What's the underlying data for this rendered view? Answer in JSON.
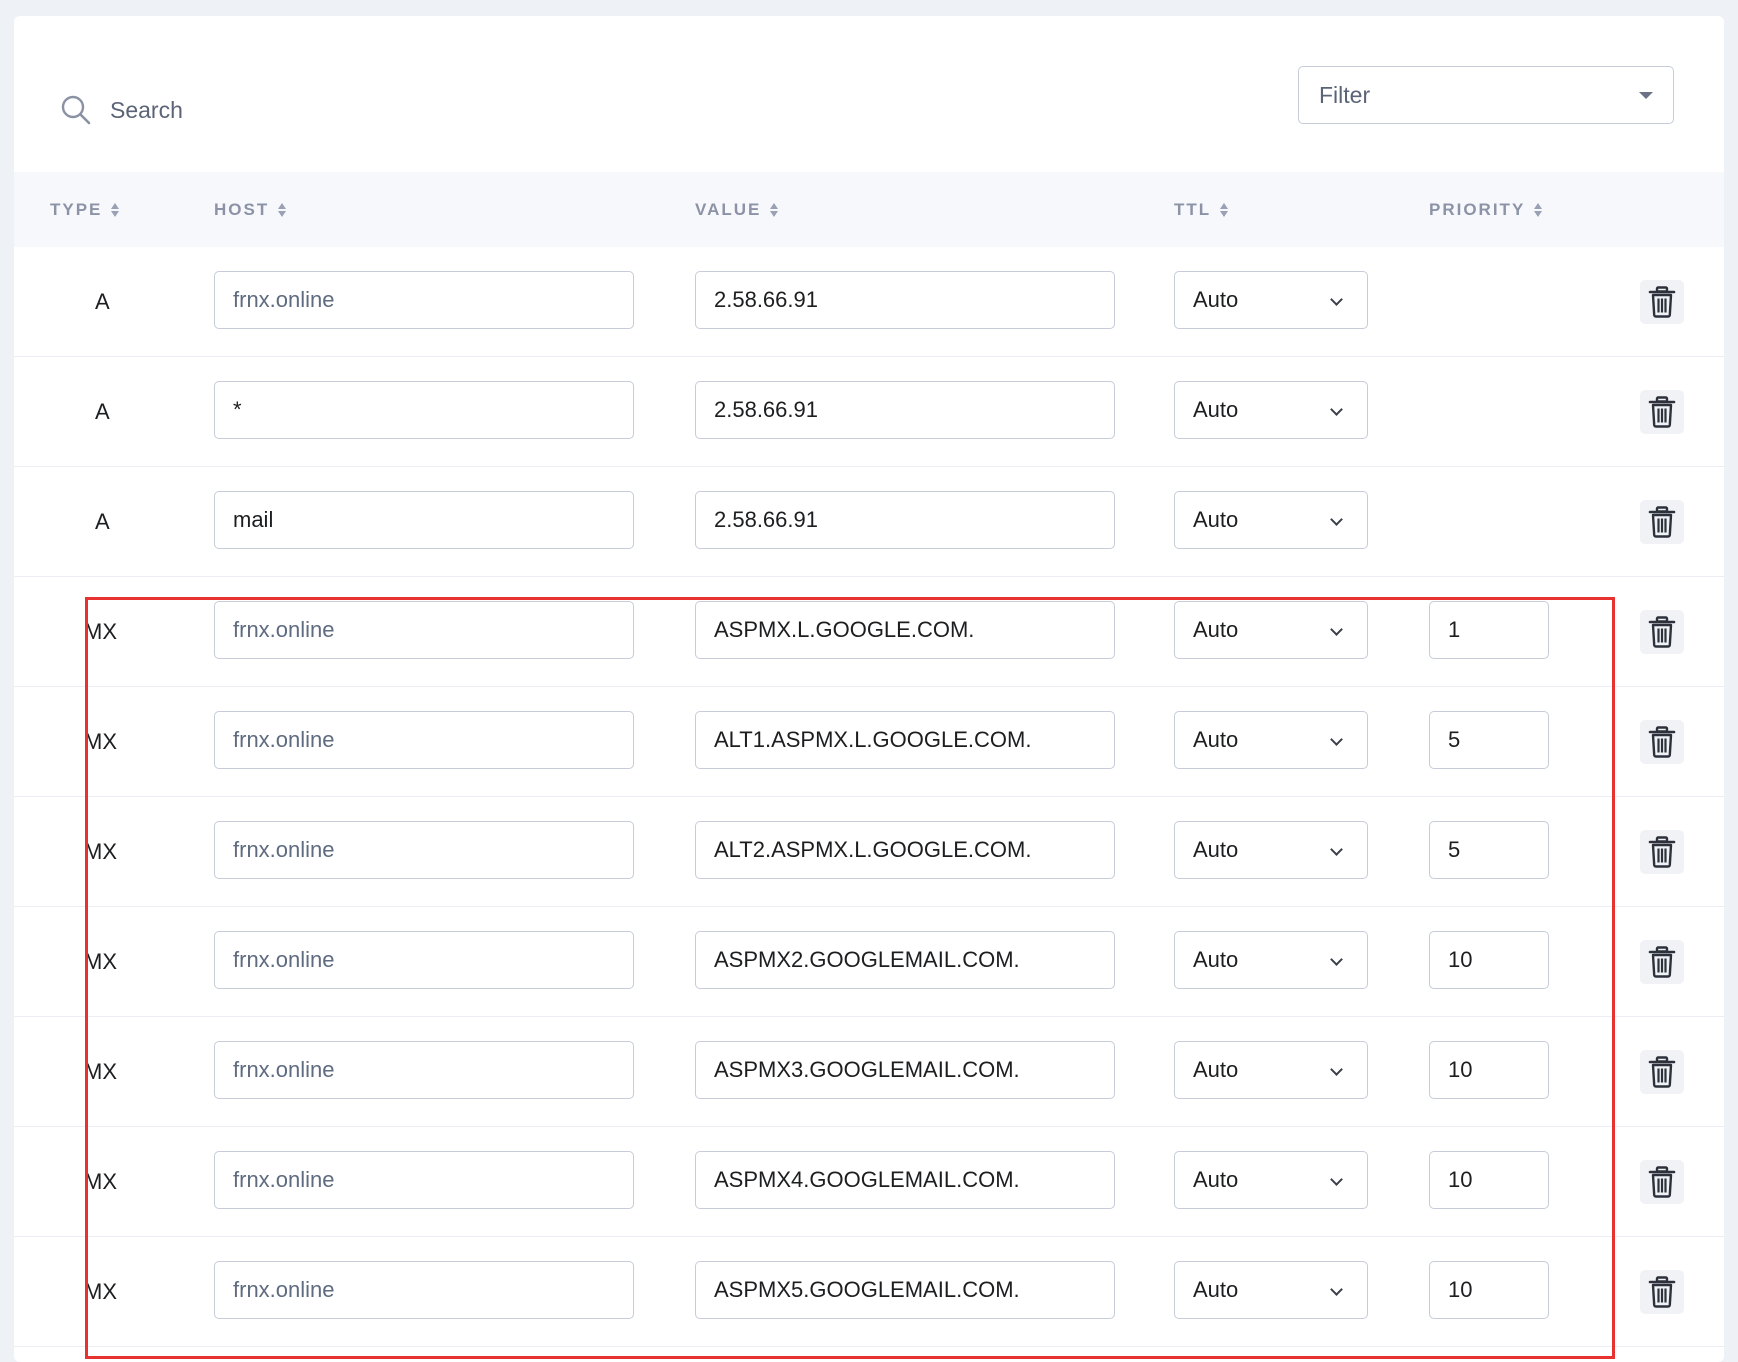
{
  "toolbar": {
    "search_label": "Search",
    "filter_label": "Filter"
  },
  "columns": [
    "TYPE",
    "HOST",
    "VALUE",
    "TTL",
    "PRIORITY"
  ],
  "records": [
    {
      "type": "A",
      "host": "frnx.online",
      "host_is_placeholder": true,
      "value": "2.58.66.91",
      "ttl": "Auto",
      "priority": ""
    },
    {
      "type": "A",
      "host": "*",
      "host_is_placeholder": false,
      "value": "2.58.66.91",
      "ttl": "Auto",
      "priority": ""
    },
    {
      "type": "A",
      "host": "mail",
      "host_is_placeholder": false,
      "value": "2.58.66.91",
      "ttl": "Auto",
      "priority": ""
    },
    {
      "type": "MX",
      "host": "frnx.online",
      "host_is_placeholder": true,
      "value": "ASPMX.L.GOOGLE.COM.",
      "ttl": "Auto",
      "priority": "1"
    },
    {
      "type": "MX",
      "host": "frnx.online",
      "host_is_placeholder": true,
      "value": "ALT1.ASPMX.L.GOOGLE.COM.",
      "ttl": "Auto",
      "priority": "5"
    },
    {
      "type": "MX",
      "host": "frnx.online",
      "host_is_placeholder": true,
      "value": "ALT2.ASPMX.L.GOOGLE.COM.",
      "ttl": "Auto",
      "priority": "5"
    },
    {
      "type": "MX",
      "host": "frnx.online",
      "host_is_placeholder": true,
      "value": "ASPMX2.GOOGLEMAIL.COM.",
      "ttl": "Auto",
      "priority": "10"
    },
    {
      "type": "MX",
      "host": "frnx.online",
      "host_is_placeholder": true,
      "value": "ASPMX3.GOOGLEMAIL.COM.",
      "ttl": "Auto",
      "priority": "10"
    },
    {
      "type": "MX",
      "host": "frnx.online",
      "host_is_placeholder": true,
      "value": "ASPMX4.GOOGLEMAIL.COM.",
      "ttl": "Auto",
      "priority": "10"
    },
    {
      "type": "MX",
      "host": "frnx.online",
      "host_is_placeholder": true,
      "value": "ASPMX5.GOOGLEMAIL.COM.",
      "ttl": "Auto",
      "priority": "10"
    }
  ],
  "icons": {
    "search": "search-icon",
    "filter_caret": "caret-down-icon",
    "sort": "sort-icon",
    "ttl_chevron": "chevron-down-icon",
    "delete": "trash-icon"
  },
  "colors": {
    "highlight": "#e8322f",
    "header_text": "#8c93a7",
    "input_border": "#c6ccd8"
  }
}
